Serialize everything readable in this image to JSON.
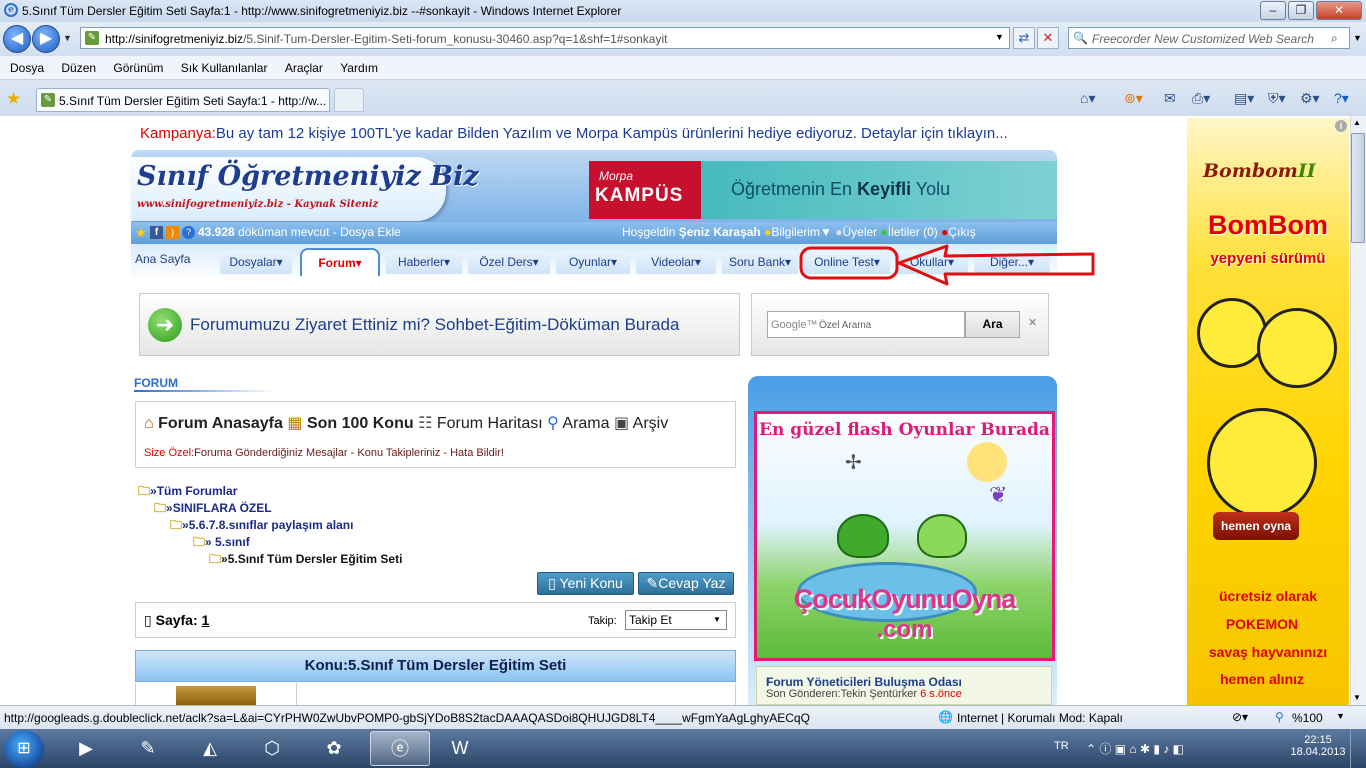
{
  "window": {
    "title": "5.Sınıf Tüm Dersler Eğitim Seti Sayfa:1 - http://www.sinifogretmeniyiz.biz --#sonkayit - Windows Internet Explorer",
    "min": "‒",
    "max": "❐",
    "close": "✕"
  },
  "address": {
    "url_domain": "http://sinifogretmeniyiz.biz",
    "url_path": "/5.Sinif-Tum-Dersler-Egitim-Seti-forum_konusu-30460.asp?q=1&shf=1#sonkayit",
    "search_placeholder": "Freecorder New Customized Web Search"
  },
  "menu": [
    "Dosya",
    "Düzen",
    "Görünüm",
    "Sık Kullanılanlar",
    "Araçlar",
    "Yardım"
  ],
  "tab": {
    "label": "5.Sınıf Tüm Dersler Eğitim Seti Sayfa:1 - http://w..."
  },
  "campaign": {
    "prefix": "Kampanya:",
    "text": "Bu ay tam 12 kişiye 100TL'ye kadar Bilden Yazılım ve Morpa Kampüs ürünlerini hediye ediyoruz. Detaylar için tıklayın..."
  },
  "site": {
    "logo_main": "Sınıf Öğretmeniyiz Biz",
    "logo_sub": "www.sinifogretmeniyiz.biz - Kaynak Siteniz",
    "banner_brand_top": "Morpa",
    "banner_brand": "KAMPÜS",
    "banner_slogan_a": "Öğretmenin En ",
    "banner_slogan_b": "Keyifli",
    "banner_slogan_c": " Yolu",
    "doc_count": "43.928",
    "doc_text": "döküman mevcut - Dosya Ekle",
    "welcome_prefix": "Hoşgeldin ",
    "welcome_user": "Şeniz Karaşah",
    "link_info": "Bilgilerim▼",
    "link_members": "Üyeler",
    "link_messages": "İletiler (0)",
    "link_logout": "Çıkış"
  },
  "nav": [
    "Ana Sayfa",
    "Dosyalar▾",
    "Forum▾",
    "Haberler▾",
    "Özel Ders▾",
    "Oyunlar▾",
    "Videolar▾",
    "Soru Bank▾",
    "Online Test▾",
    "Okullar▾",
    "Diğer...▾"
  ],
  "visit_banner": "Forumumuzu Ziyaret Ettiniz mi? Sohbet-Eğitim-Döküman Burada",
  "google": {
    "logo": "Google™",
    "placeholder": "Özel Arama",
    "button": "Ara",
    "close": "✕"
  },
  "forum": {
    "section_label": "FORUM",
    "links": [
      "Forum Anasayfa",
      "Son 100 Konu",
      "Forum Haritası",
      "Arama",
      "Arşiv"
    ],
    "special_prefix": "Size Özel:",
    "special_text": "Foruma Gönderdiğiniz Mesajlar - Konu Takipleriniz - Hata Bildir!",
    "tree": [
      "»Tüm Forumlar",
      "»SINIFLARA ÖZEL",
      "»5.6.7.8.sınıflar paylaşım alanı",
      "» 5.sınıf",
      "»5.Sınıf Tüm Dersler Eğitim Seti"
    ],
    "btn_new": "Yeni Konu",
    "btn_reply": "Cevap Yaz",
    "page_label": "Sayfa:",
    "page_num": "1",
    "follow_label": "Takip:",
    "follow_value": "Takip Et",
    "topic_title": "Konu:5.Sınıf Tüm Dersler Eğitim Seti"
  },
  "side_ad": {
    "title": "En güzel flash Oyunlar Burada",
    "brand_a": "ÇocukOyunuOyna",
    "brand_b": ".com"
  },
  "moderators": {
    "title": "Forum Yöneticileri Buluşma Odası",
    "sender_label": "Son Gönderen:",
    "sender": "Tekin Şentürker",
    "time": "6 s.önce"
  },
  "right_ad": {
    "logo": "Bombom",
    "roman": "II",
    "title": "BomBom",
    "subtitle": "yepyeni sürümü",
    "play": "hemen oyna",
    "line1": "ücretsiz olarak",
    "line2": "POKEMON",
    "line3": "savaş hayvanınızı",
    "line4": "hemen alınız",
    "info": "i"
  },
  "status": {
    "url": "http://googleads.g.doubleclick.net/aclk?sa=L&ai=CYrPHW0ZwUbvPOMP0-gbSjYDoB8S2tacDAAAQASDoi8QHUJGD8LT4____wFgmYaAgLghyAECqQ",
    "zone": "Internet | Korumalı Mod: Kapalı",
    "zoom": "%100"
  },
  "taskbar": {
    "lang": "TR",
    "time": "22:15",
    "date": "18.04.2013"
  },
  "colors": {
    "accent_red": "#e00000",
    "nav_blue": "#1c3f8a"
  }
}
